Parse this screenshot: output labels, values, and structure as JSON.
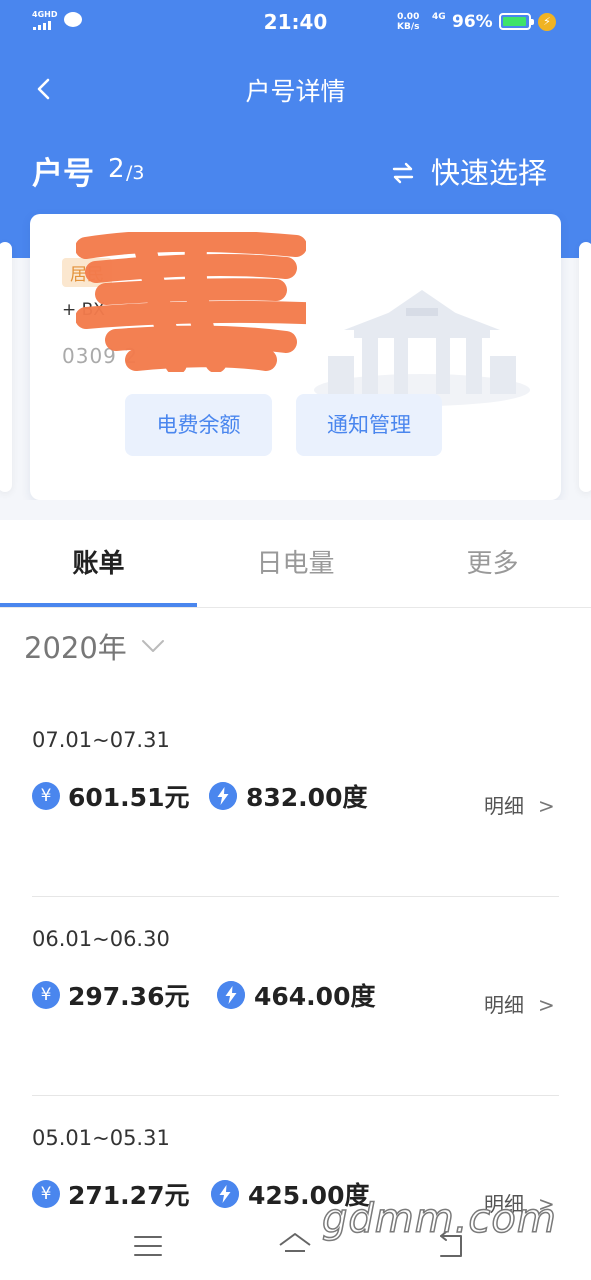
{
  "status_bar": {
    "network": "4GHD",
    "time": "21:40",
    "speed_value": "0.00",
    "speed_unit": "KB/s",
    "net_type": "4G",
    "battery": "96%",
    "battery_level": 0.96,
    "battery_color": "#3fe36a"
  },
  "header": {
    "title": "户号详情",
    "back_icon": "chevron-left-icon",
    "account_label": "户号",
    "account_current": "2",
    "account_total": "/3",
    "quick_select_label": "快速选择",
    "swap_icon": "swap-arrows-icon"
  },
  "card": {
    "tag": "居民",
    "address": "+ BX",
    "account_no": "0309 2",
    "buttons": {
      "balance": "电费余额",
      "notify": "通知管理"
    }
  },
  "tabs": [
    {
      "label": "账单",
      "active": true
    },
    {
      "label": "日电量",
      "active": false
    },
    {
      "label": "更多",
      "active": false
    }
  ],
  "year": "2020年",
  "bills": [
    {
      "period": "07.01~07.31",
      "amount": "601.51元",
      "usage": "832.00度",
      "detail": "明细",
      "arrow": ">"
    },
    {
      "period": "06.01~06.30",
      "amount": "297.36元",
      "usage": "464.00度",
      "detail": "明细",
      "arrow": ">"
    },
    {
      "period": "05.01~05.31",
      "amount": "271.27元",
      "usage": "425.00度",
      "detail": "明细",
      "arrow": ">"
    }
  ],
  "watermark": "gdmm.com",
  "colors": {
    "primary": "#4a86ee",
    "tag_bg": "#fbe7cf",
    "tag_text": "#e3923a",
    "redaction": "#f37b4c"
  }
}
